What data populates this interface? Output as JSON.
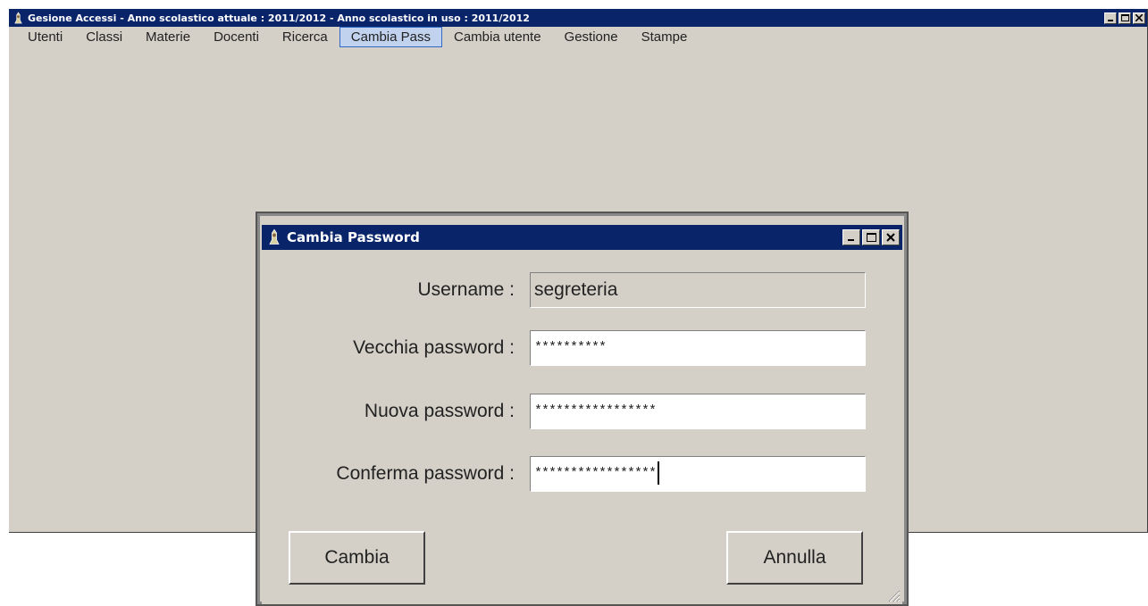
{
  "app": {
    "title": "Gesione Accessi - Anno scolastico attuale : 2011/2012 - Anno scolastico in uso : 2011/2012",
    "icon": "app-logo-icon"
  },
  "menu": {
    "items": [
      {
        "label": "Utenti",
        "active": false
      },
      {
        "label": "Classi",
        "active": false
      },
      {
        "label": "Materie",
        "active": false
      },
      {
        "label": "Docenti",
        "active": false
      },
      {
        "label": "Ricerca",
        "active": false
      },
      {
        "label": "Cambia Pass",
        "active": true
      },
      {
        "label": "Cambia utente",
        "active": false
      },
      {
        "label": "Gestione",
        "active": false
      },
      {
        "label": "Stampe",
        "active": false
      }
    ]
  },
  "dialog": {
    "title": "Cambia Password",
    "username_label": "Username :",
    "username_value": "segreteria",
    "old_pw_label": "Vecchia password :",
    "old_pw_value": "**********",
    "new_pw_label": "Nuova password :",
    "new_pw_value": "*****************",
    "confirm_pw_label": "Conferma password :",
    "confirm_pw_value": "*****************",
    "ok_label": "Cambia",
    "cancel_label": "Annulla"
  },
  "colors": {
    "titlebar": "#0a246a",
    "face": "#d4d0c8",
    "menu_active_bg": "#c1d2ee",
    "menu_active_border": "#316ac5"
  }
}
